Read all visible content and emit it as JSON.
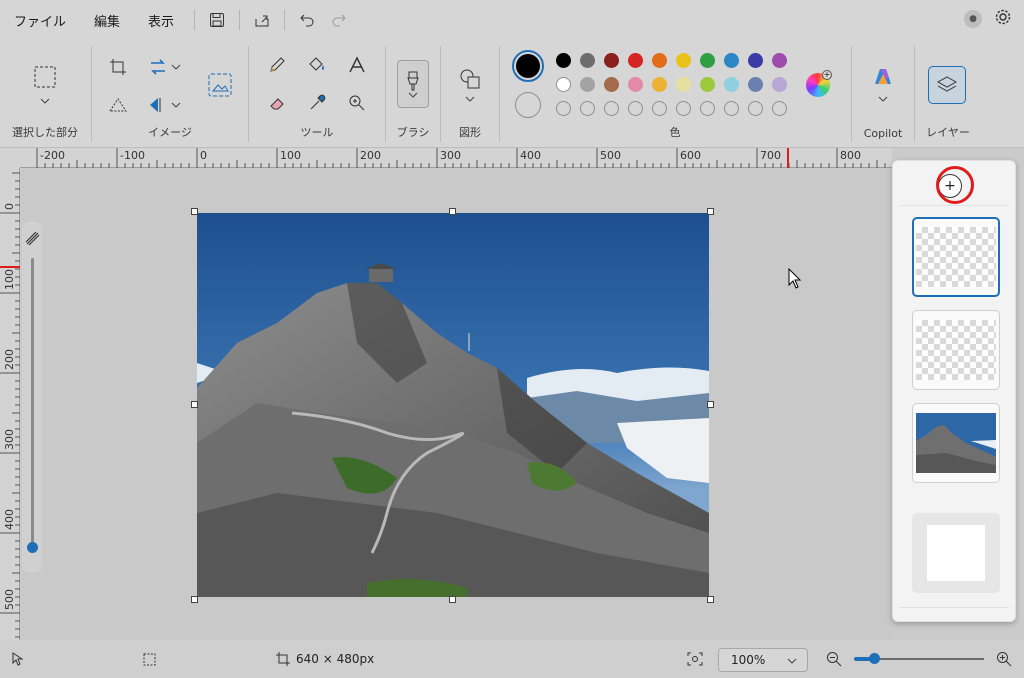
{
  "menu": {
    "file": "ファイル",
    "edit": "編集",
    "view": "表示"
  },
  "ribbon": {
    "groups": {
      "selection": "選択した部分",
      "image": "イメージ",
      "tools": "ツール",
      "brush": "ブラシ",
      "shapes": "図形",
      "colors": "色",
      "copilot": "Copilot",
      "layers": "レイヤー"
    },
    "palette_row1": [
      "#000000",
      "#6d6d6d",
      "#8a1f1f",
      "#d62424",
      "#e36c1b",
      "#e8c21b",
      "#2ea043",
      "#2a86c4",
      "#3b3ba8",
      "#9c4cab"
    ],
    "palette_row2": [
      "#ffffff",
      "#a3a3a3",
      "#a36a4b",
      "#e28aa8",
      "#ecb236",
      "#e6e0a0",
      "#9cc93b",
      "#8fd0e0",
      "#6b7fb0",
      "#b8a6d4"
    ],
    "primary_color": "#000000",
    "secondary_color": "#ffffff"
  },
  "ruler": {
    "top_labels": [
      "-200",
      "-100",
      "0",
      "100",
      "200",
      "300",
      "400",
      "500",
      "600",
      "700",
      "800"
    ],
    "left_labels": [
      "0",
      "100",
      "200",
      "300",
      "400",
      "500"
    ]
  },
  "status": {
    "canvas_size": "640 × 480px",
    "zoom": "100%"
  },
  "zoom_level": 0.15
}
